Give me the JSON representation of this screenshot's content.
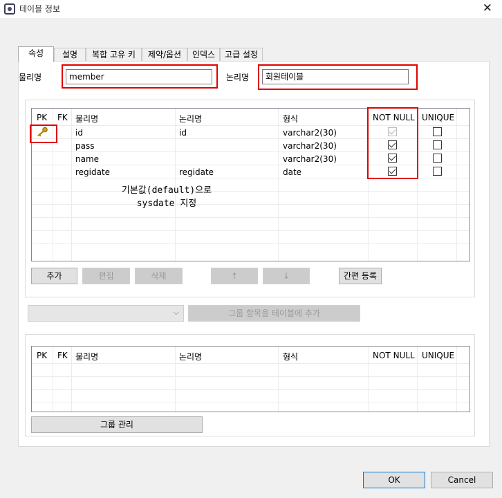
{
  "window": {
    "title": "테이블 정보",
    "close_glyph": "✕"
  },
  "tabs": [
    {
      "label": "속성",
      "active": true
    },
    {
      "label": "설명"
    },
    {
      "label": "복합 고유 키"
    },
    {
      "label": "제약/옵션"
    },
    {
      "label": "인덱스"
    },
    {
      "label": "고급 설정"
    }
  ],
  "form": {
    "physical_label": "물리명",
    "physical_value": "member",
    "logical_label": "논리명",
    "logical_value": "회원테이블"
  },
  "columns_table": {
    "headers": [
      "PK",
      "FK",
      "물리명",
      "논리명",
      "형식",
      "NOT NULL",
      "UNIQUE"
    ],
    "rows": [
      {
        "pk": true,
        "fk": false,
        "physical": "id",
        "logical": "id",
        "type": "varchar2(30)",
        "not_null": true,
        "not_null_disabled": true,
        "unique": false
      },
      {
        "pk": false,
        "fk": false,
        "physical": "pass",
        "logical": "",
        "type": "varchar2(30)",
        "not_null": true,
        "unique": false
      },
      {
        "pk": false,
        "fk": false,
        "physical": "name",
        "logical": "",
        "type": "varchar2(30)",
        "not_null": true,
        "unique": false
      },
      {
        "pk": false,
        "fk": false,
        "physical": "regidate",
        "logical": "regidate",
        "type": "date",
        "not_null": true,
        "unique": false
      }
    ],
    "pk_icon": "key-icon"
  },
  "annotation": {
    "line1": "기본값(default)으로",
    "line2": "sysdate 지정"
  },
  "buttons": {
    "add": "추가",
    "edit": "편집",
    "delete": "삭제",
    "up": "↑",
    "down": "↓",
    "quick_register": "간편 등록",
    "add_group_to_table": "그룹 항목을 테이블에 추가",
    "manage_group": "그룹 관리",
    "ok": "OK",
    "cancel": "Cancel"
  },
  "group_select": {
    "value": "",
    "arrow": "⌵"
  },
  "group_table": {
    "headers": [
      "PK",
      "FK",
      "물리명",
      "논리명",
      "형식",
      "NOT NULL",
      "UNIQUE"
    ],
    "rows": []
  },
  "colors": {
    "highlight": "#e00000",
    "key": "#d4a017"
  }
}
